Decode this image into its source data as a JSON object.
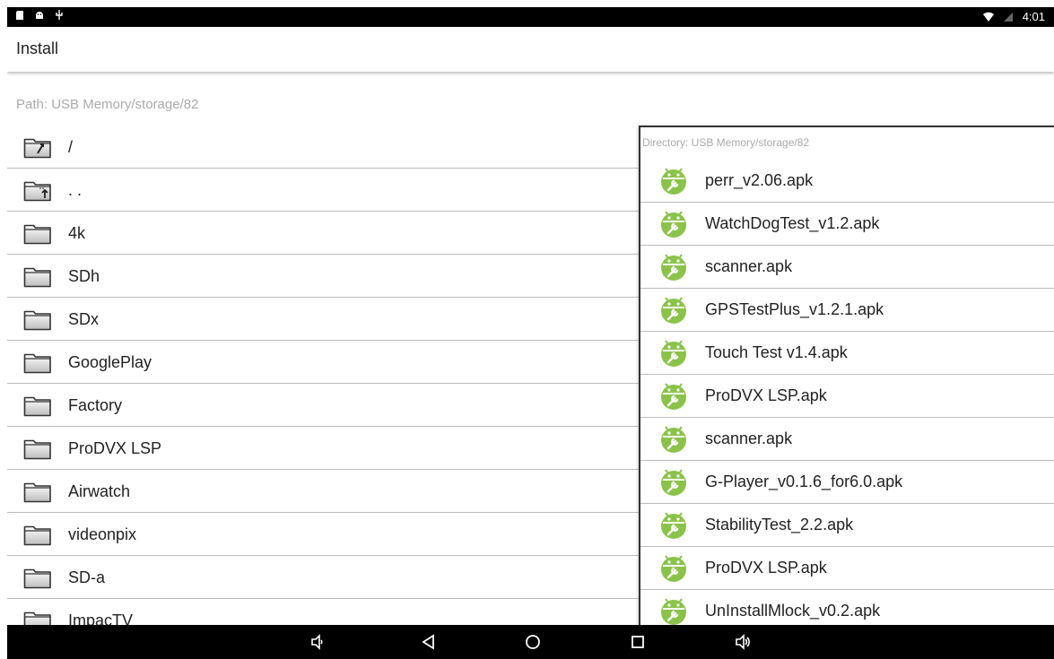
{
  "status_bar": {
    "left_icons": [
      "sd-card-icon",
      "android-icon",
      "usb-icon"
    ],
    "time": "4:01",
    "right_icons": [
      "wifi-icon",
      "no-signal-icon"
    ]
  },
  "app_bar": {
    "title": "Install"
  },
  "path": {
    "label": "Path:  USB Memory/storage/82"
  },
  "folders": [
    {
      "name": "/",
      "icon": "folder-root-icon"
    },
    {
      "name": ". .",
      "icon": "folder-up-icon"
    },
    {
      "name": "4k",
      "icon": "folder-icon"
    },
    {
      "name": "SDh",
      "icon": "folder-icon"
    },
    {
      "name": "SDx",
      "icon": "folder-icon"
    },
    {
      "name": "GooglePlay",
      "icon": "folder-icon"
    },
    {
      "name": "Factory",
      "icon": "folder-icon"
    },
    {
      "name": "ProDVX LSP",
      "icon": "folder-icon"
    },
    {
      "name": "Airwatch",
      "icon": "folder-icon"
    },
    {
      "name": "videonpix",
      "icon": "folder-icon"
    },
    {
      "name": "SD-a",
      "icon": "folder-icon"
    },
    {
      "name": "ImpacTV",
      "icon": "folder-icon"
    }
  ],
  "directory_panel": {
    "label": "Directory:  USB Memory/storage/82",
    "files": [
      "perr_v2.06.apk",
      "WatchDogTest_v1.2.apk",
      "scanner.apk",
      "GPSTestPlus_v1.2.1.apk",
      "Touch Test v1.4.apk",
      "ProDVX LSP.apk",
      "scanner.apk",
      "G-Player_v0.1.6_for6.0.apk",
      "StabilityTest_2.2.apk",
      "ProDVX LSP.apk",
      "UnInstallMlock_v0.2.apk"
    ]
  },
  "nav_bar": {
    "buttons": [
      "volume-down-icon",
      "back-icon",
      "home-icon",
      "recents-icon",
      "volume-up-icon"
    ]
  },
  "colors": {
    "android_green": "#8bc34a",
    "status_bar": "#000000",
    "divider": "#bdbdbd"
  }
}
